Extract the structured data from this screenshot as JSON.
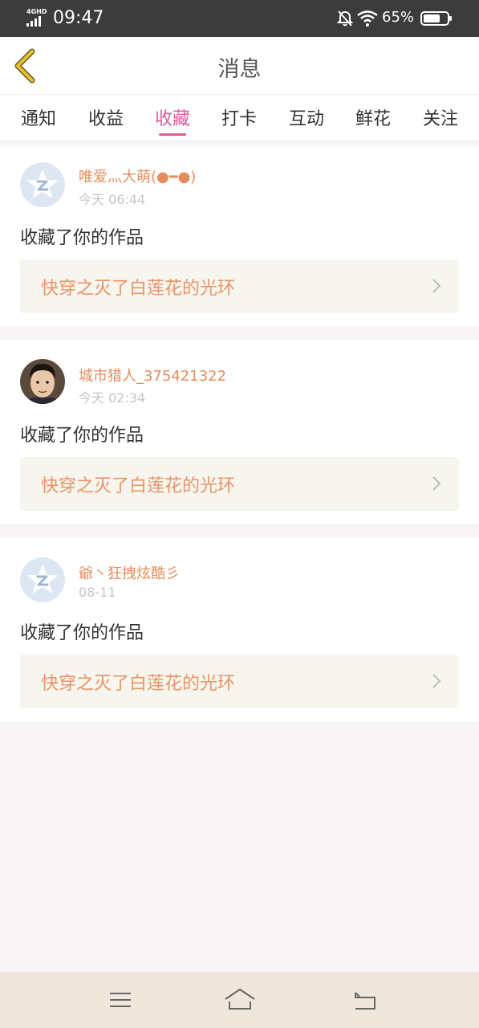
{
  "status_bar": {
    "network": "4GHD",
    "time": "09:47",
    "battery": "65%",
    "icons": [
      "signal-icon",
      "bell-off-icon",
      "wifi-icon",
      "battery-icon"
    ]
  },
  "header": {
    "title": "消息",
    "back_icon": "chevron-left-icon"
  },
  "tabs": [
    {
      "label": "通知"
    },
    {
      "label": "收益"
    },
    {
      "label": "收藏"
    },
    {
      "label": "打卡"
    },
    {
      "label": "互动"
    },
    {
      "label": "鲜花"
    },
    {
      "label": "关注"
    }
  ],
  "active_tab": "收藏",
  "messages": [
    {
      "user": "唯爱灬大萌(●━●)",
      "time": "今天 06:44",
      "action": "收藏了你的作品",
      "work": "快穿之灭了白莲花的光环",
      "avatar": "default-avatar-icon"
    },
    {
      "user": "城市猎人_375421322",
      "time": "今天 02:34",
      "action": "收藏了你的作品",
      "work": "快穿之灭了白莲花的光环",
      "avatar": "user-photo"
    },
    {
      "user": "爺丶狂拽炫酷彡",
      "time": "08-11",
      "action": "收藏了你的作品",
      "work": "快穿之灭了白莲花的光环",
      "avatar": "default-avatar-icon"
    }
  ],
  "colors": {
    "accent": "#df5b9a",
    "username": "#e98c5c",
    "work_title": "#ea9364",
    "back_arrow": "#e8c22a",
    "nav_bar": "#f1e6db"
  },
  "nav_icons": [
    "menu-icon",
    "home-icon",
    "back-icon"
  ]
}
